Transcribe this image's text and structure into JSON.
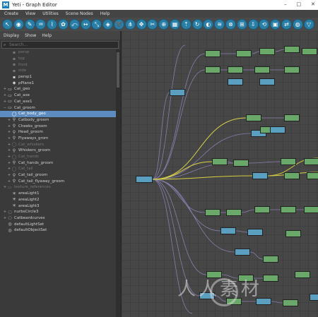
{
  "window": {
    "title": "Yeti - Graph Editor",
    "logo": "M",
    "controls": [
      "–",
      "□",
      "✕"
    ]
  },
  "menubar": [
    "Create",
    "View",
    "Utilities",
    "Scene Nodes",
    "Help"
  ],
  "toolbar": {
    "icons": [
      "select-icon",
      "scatter-icon",
      "brush-icon",
      "clump-icon",
      "guide-icon",
      "groom-icon",
      "bend-icon",
      "width-icon",
      "scale-icon",
      "attribute-icon",
      "curl-icon",
      "comb-icon",
      "move-icon",
      "cut-icon",
      "stamp-icon",
      "texture-icon",
      "grow-icon",
      "twist-icon",
      "blend-icon",
      "noise-icon",
      "collide-icon",
      "merge-icon",
      "import-icon",
      "transform-icon",
      "cache-icon",
      "convert-icon",
      "isolate-icon",
      "filter-icon"
    ]
  },
  "outliner": {
    "menu": [
      "Display",
      "Show",
      "Help"
    ],
    "search_placeholder": "Search...",
    "items": [
      {
        "label": "persp",
        "indent": 1,
        "icon": "camera-icon",
        "glyph": "▪",
        "dim": true,
        "exp": ""
      },
      {
        "label": "top",
        "indent": 1,
        "icon": "camera-icon",
        "glyph": "▪",
        "dim": true,
        "exp": ""
      },
      {
        "label": "front",
        "indent": 1,
        "icon": "camera-icon",
        "glyph": "▪",
        "dim": true,
        "exp": ""
      },
      {
        "label": "side",
        "indent": 1,
        "icon": "camera-icon",
        "glyph": "▪",
        "dim": true,
        "exp": ""
      },
      {
        "label": "persp1",
        "indent": 1,
        "icon": "camera-icon",
        "glyph": "▪",
        "dim": false,
        "exp": ""
      },
      {
        "label": "pPlane1",
        "indent": 1,
        "icon": "mesh-icon",
        "glyph": "◆",
        "dim": false,
        "exp": ""
      },
      {
        "label": "Cat_geo",
        "indent": 0,
        "icon": "group-icon",
        "glyph": "▭",
        "dim": false,
        "exp": "+"
      },
      {
        "label": "Cat_axe",
        "indent": 0,
        "icon": "group-icon",
        "glyph": "▭",
        "dim": false,
        "exp": "+"
      },
      {
        "label": "Cat_axe1",
        "indent": 0,
        "icon": "group-icon",
        "glyph": "▭",
        "dim": false,
        "exp": "+"
      },
      {
        "label": "Cat_groom",
        "indent": 0,
        "icon": "group-icon",
        "glyph": "▭",
        "dim": false,
        "exp": "−"
      },
      {
        "label": "Cat_body_geo",
        "indent": 1,
        "icon": "yeti-node-icon",
        "glyph": "◯",
        "dim": false,
        "exp": "",
        "selected": true
      },
      {
        "label": "Catbody_groom",
        "indent": 1,
        "icon": "groom-icon",
        "glyph": "⚲",
        "dim": false,
        "exp": "+"
      },
      {
        "label": "Cheeks_groom",
        "indent": 1,
        "icon": "groom-icon",
        "glyph": "⚲",
        "dim": false,
        "exp": "+"
      },
      {
        "label": "Head_groom",
        "indent": 1,
        "icon": "groom-icon",
        "glyph": "⚲",
        "dim": false,
        "exp": "+"
      },
      {
        "label": "Flyaways_grom",
        "indent": 1,
        "icon": "groom-icon",
        "glyph": "⚲",
        "dim": false,
        "exp": "+"
      },
      {
        "label": "Cat_whiskers",
        "indent": 1,
        "icon": "yeti-node-icon",
        "glyph": "◯",
        "dim": true,
        "exp": "+"
      },
      {
        "label": "Whiskers_groom",
        "indent": 1,
        "icon": "groom-icon",
        "glyph": "⚲",
        "dim": false,
        "exp": "+"
      },
      {
        "label": "Cat_hands",
        "indent": 1,
        "icon": "yeti-node-icon",
        "glyph": "◯",
        "dim": true,
        "exp": "+"
      },
      {
        "label": "Cat_hands_groom",
        "indent": 1,
        "icon": "groom-icon",
        "glyph": "⚲",
        "dim": false,
        "exp": "+"
      },
      {
        "label": "Cat_tail",
        "indent": 1,
        "icon": "yeti-node-icon",
        "glyph": "◯",
        "dim": true,
        "exp": "+"
      },
      {
        "label": "Cat_tail_groom",
        "indent": 1,
        "icon": "groom-icon",
        "glyph": "⚲",
        "dim": false,
        "exp": "+"
      },
      {
        "label": "Cat_tail_flyaway_groom",
        "indent": 1,
        "icon": "groom-icon",
        "glyph": "⚲",
        "dim": false,
        "exp": "+"
      },
      {
        "label": "texture_references",
        "indent": 0,
        "icon": "group-icon",
        "glyph": "▭",
        "dim": true,
        "exp": "+"
      },
      {
        "label": "areaLight1",
        "indent": 1,
        "icon": "light-icon",
        "glyph": "✳",
        "dim": false,
        "exp": ""
      },
      {
        "label": "areaLight2",
        "indent": 1,
        "icon": "light-icon",
        "glyph": "✳",
        "dim": false,
        "exp": ""
      },
      {
        "label": "areaLight3",
        "indent": 1,
        "icon": "light-icon",
        "glyph": "✳",
        "dim": false,
        "exp": ""
      },
      {
        "label": "nurbsCircle3",
        "indent": 0,
        "icon": "curve-icon",
        "glyph": "◌",
        "dim": false,
        "exp": "+"
      },
      {
        "label": "Catbeardcurves",
        "indent": 0,
        "icon": "curve-icon",
        "glyph": "◌",
        "dim": false,
        "exp": "+"
      },
      {
        "label": "defaultLightSet",
        "indent": 0,
        "icon": "set-icon",
        "glyph": "◎",
        "dim": false,
        "exp": ""
      },
      {
        "label": "defaultObjectSet",
        "indent": 0,
        "icon": "set-icon",
        "glyph": "◎",
        "dim": false,
        "exp": ""
      }
    ]
  },
  "graph": {
    "colors": {
      "green": "#6aa86a",
      "blue": "#5b9fc0",
      "wire": "#8a7fae",
      "wire_active": "#d8d040"
    },
    "watermark": "人人素材"
  }
}
